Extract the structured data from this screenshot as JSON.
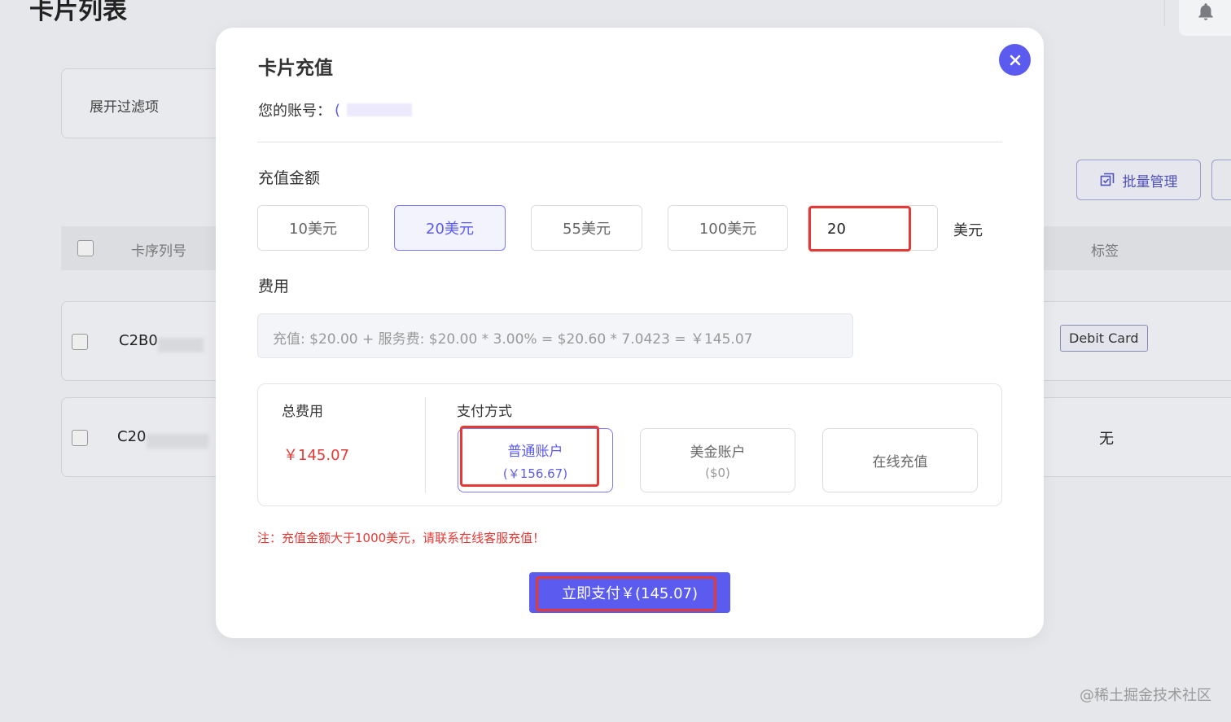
{
  "background": {
    "page_title": "卡片列表",
    "filter_label": "展开过滤项",
    "batch_button": "批量管理",
    "table_headers": {
      "serial": "卡序列号",
      "tag": "标签"
    },
    "rows": [
      {
        "serial": "C2B0",
        "tag": "Debit Card"
      },
      {
        "serial": "C20",
        "tag": "无"
      }
    ],
    "watermark": "@稀土掘金技术社区"
  },
  "modal": {
    "title": "卡片充值",
    "account_label": "您的账号：",
    "account_value": "(",
    "amount_label": "充值金额",
    "amount_options": [
      "10美元",
      "20美元",
      "55美元",
      "100美元"
    ],
    "selected_amount_index": 1,
    "custom_amount": "20",
    "unit": "美元",
    "fee_label": "费用",
    "fee_formula": "充值: $20.00 + 服务费: $20.00 * 3.00% = $20.60 * 7.0423 = ￥145.07",
    "total_label": "总费用",
    "total_value": "￥145.07",
    "pay_method_label": "支付方式",
    "pay_methods": [
      {
        "name": "普通账户",
        "sub": "(￥156.67)"
      },
      {
        "name": "美金账户",
        "sub": "($0)"
      },
      {
        "name": "在线充值",
        "sub": ""
      }
    ],
    "selected_pay_index": 0,
    "note": "注：充值金额大于1000美元，请联系在线客服充值！",
    "submit_label": "立即支付￥(145.07)"
  },
  "colors": {
    "accent": "#5b5bf0",
    "highlight": "#e53935",
    "price": "#e53935"
  },
  "icons": [
    "bell-icon",
    "close-icon",
    "batch-manage-icon"
  ]
}
